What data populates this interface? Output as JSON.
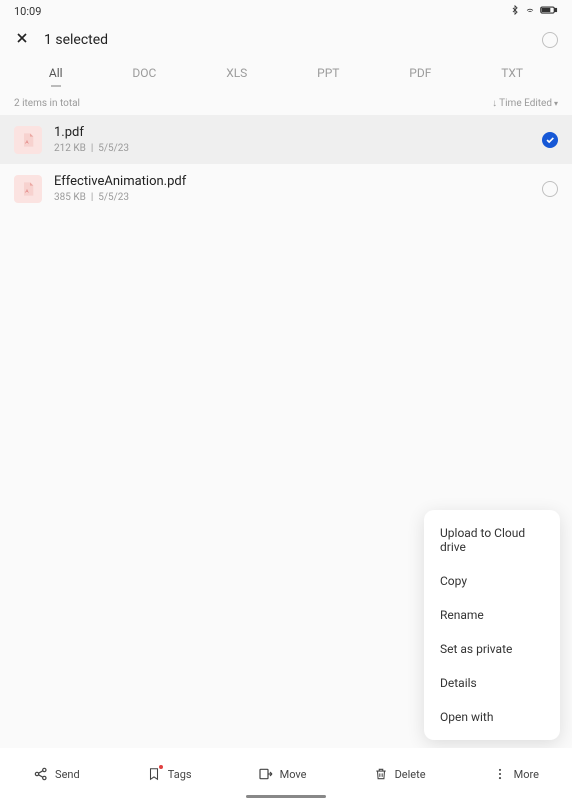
{
  "status": {
    "time": "10:09",
    "icons": [
      "bluetooth",
      "wifi",
      "battery"
    ]
  },
  "header": {
    "title": "1 selected"
  },
  "tabs": [
    {
      "label": "All",
      "active": true
    },
    {
      "label": "DOC",
      "active": false
    },
    {
      "label": "XLS",
      "active": false
    },
    {
      "label": "PPT",
      "active": false
    },
    {
      "label": "PDF",
      "active": false
    },
    {
      "label": "TXT",
      "active": false
    }
  ],
  "meta": {
    "count": "2 items in total",
    "sort": "Time Edited"
  },
  "files": [
    {
      "name": "1.pdf",
      "size": "212 KB",
      "date": "5/5/23",
      "selected": true
    },
    {
      "name": "EffectiveAnimation.pdf",
      "size": "385 KB",
      "date": "5/5/23",
      "selected": false
    }
  ],
  "context_menu": [
    "Upload to Cloud drive",
    "Copy",
    "Rename",
    "Set as private",
    "Details",
    "Open with"
  ],
  "bottom": {
    "send": "Send",
    "tags": "Tags",
    "move": "Move",
    "delete": "Delete",
    "more": "More"
  }
}
